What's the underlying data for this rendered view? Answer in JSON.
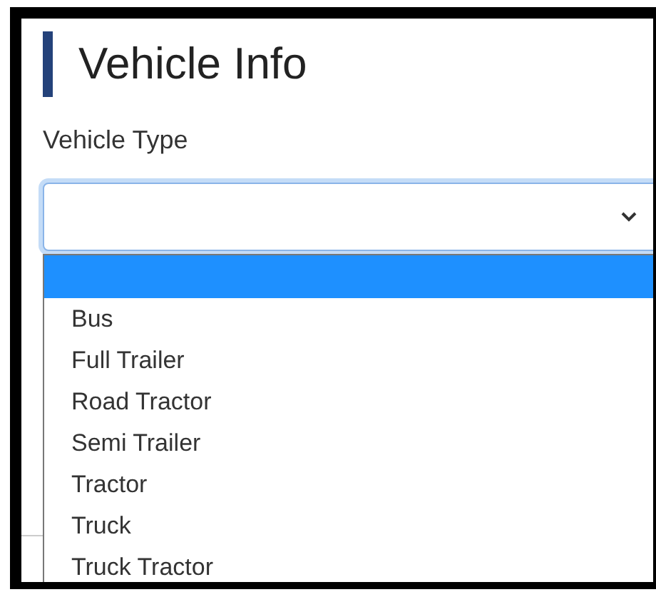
{
  "heading": "Vehicle Info",
  "field": {
    "label": "Vehicle Type",
    "expanded": true
  },
  "options": [
    {
      "selected": true
    },
    {
      "label": "Bus",
      "selected": false
    },
    {
      "label": "Full Trailer",
      "selected": false
    },
    {
      "label": "Road Tractor",
      "selected": false
    },
    {
      "label": "Semi Trailer",
      "selected": false
    },
    {
      "label": "Tractor",
      "selected": false
    },
    {
      "label": "Truck",
      "selected": false
    },
    {
      "label": "Truck Tractor",
      "selected": false
    }
  ]
}
